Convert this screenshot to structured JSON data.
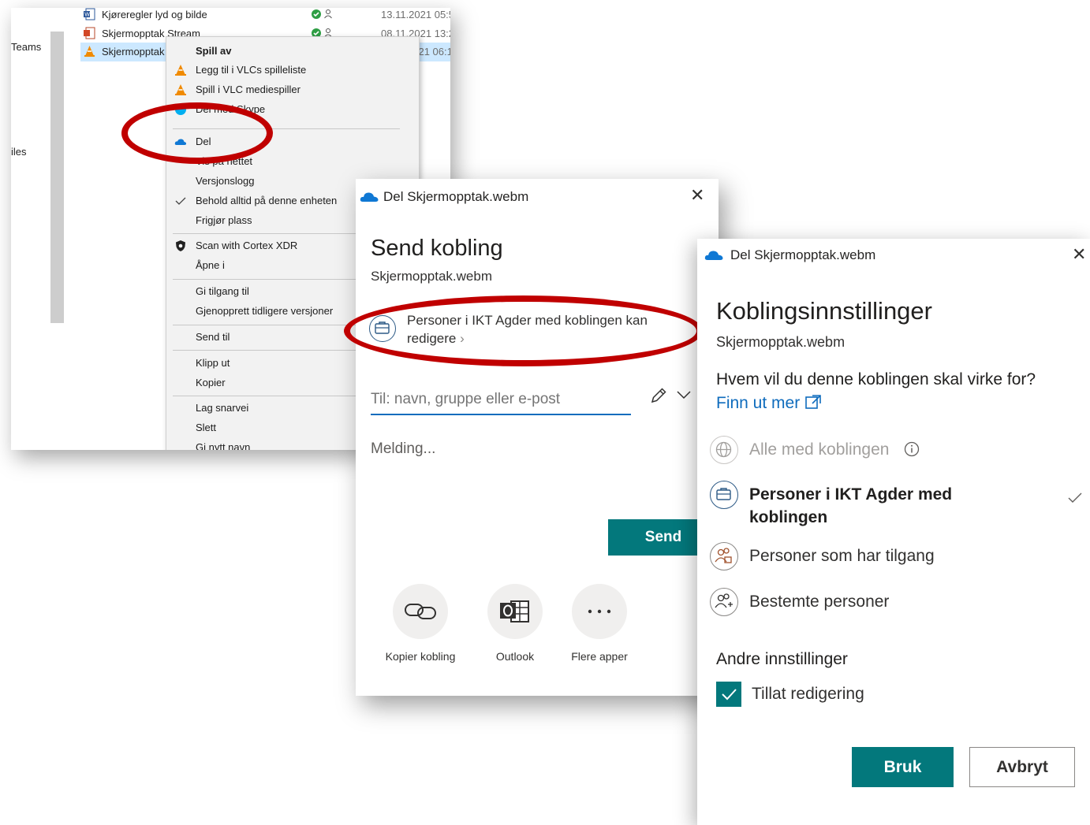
{
  "explorer": {
    "nav": {
      "teams": "Teams",
      "files": "iles"
    },
    "files": [
      {
        "name": "Kjøreregler lyd og bilde",
        "date": "13.11.2021 05:5",
        "icon": "word-doc-icon"
      },
      {
        "name": "Skjermopptak Stream",
        "date": "08.11.2021 13:2",
        "icon": "pdf-doc-icon"
      },
      {
        "name": "Skjermopptak",
        "date": "2021 06:1",
        "icon": "vlc-cone-icon"
      }
    ]
  },
  "context_menu": {
    "items": [
      "Spill av",
      "Legg til i VLCs spilleliste",
      "Spill i VLC mediespiller",
      "Del med Skype",
      "Del",
      "Vis på nettet",
      "Versjonslogg",
      "Behold alltid på denne enheten",
      "Frigjør plass",
      "Scan with Cortex XDR",
      "Åpne i",
      "Gi tilgang til",
      "Gjenopprett tidligere versjoner",
      "Send til",
      "Klipp ut",
      "Kopier",
      "Lag snarvei",
      "Slett",
      "Gi nytt navn"
    ]
  },
  "share_dialog": {
    "header_title": "Del Skjermopptak.webm",
    "heading": "Send kobling",
    "filename": "Skjermopptak.webm",
    "permission": "Personer i IKT Agder med koblingen kan redigere",
    "to_placeholder": "Til: navn, gruppe eller e-post",
    "message_placeholder": "Melding...",
    "send_label": "Send",
    "apps": [
      "Kopier kobling",
      "Outlook",
      "Flere apper"
    ]
  },
  "link_settings": {
    "header_title": "Del Skjermopptak.webm",
    "heading": "Koblingsinnstillinger",
    "filename": "Skjermopptak.webm",
    "question": "Hvem vil du denne koblingen skal virke for?",
    "learn_more": "Finn ut mer",
    "options": [
      {
        "label": "Alle med koblingen",
        "enabled": false,
        "selected": false
      },
      {
        "label": "Personer i IKT Agder med koblingen",
        "enabled": true,
        "selected": true
      },
      {
        "label": "Personer som har tilgang",
        "enabled": true,
        "selected": false
      },
      {
        "label": "Bestemte personer",
        "enabled": true,
        "selected": false
      }
    ],
    "other_settings": "Andre innstillinger",
    "allow_edit": "Tillat redigering",
    "allow_edit_checked": true,
    "apply_label": "Bruk",
    "cancel_label": "Avbryt"
  },
  "colors": {
    "accent": "#03787c",
    "link": "#0f6cbd",
    "annotation": "#c00000",
    "onedrive": "#0f78d4"
  }
}
